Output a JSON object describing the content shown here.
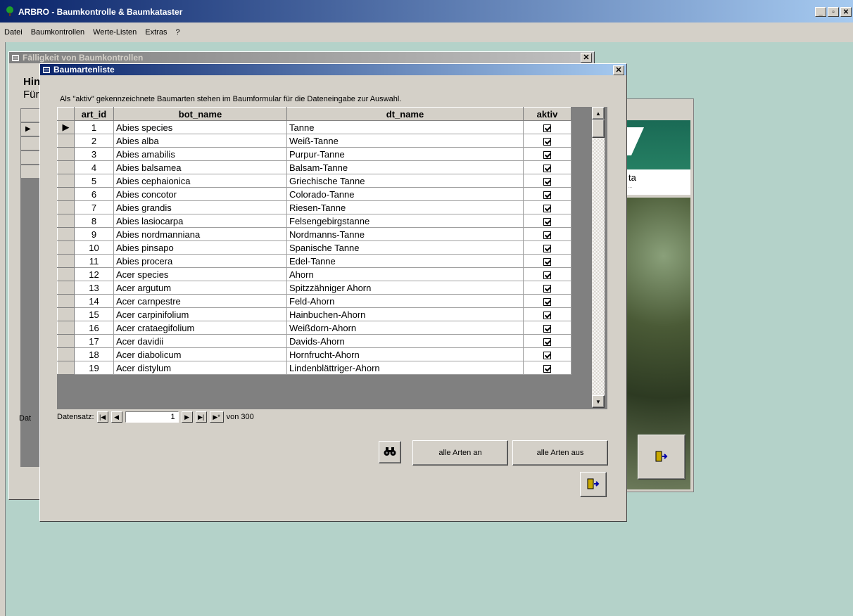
{
  "app": {
    "title": "ARBRO - Baumkontrolle & Baumkataster"
  },
  "window_controls": {
    "minimize": "_",
    "maximize": "▫",
    "close": "✕"
  },
  "menu": [
    {
      "label": "Datei"
    },
    {
      "label": "Baumkontrollen"
    },
    {
      "label": "Werte-Listen"
    },
    {
      "label": "Extras"
    },
    {
      "label": "?"
    }
  ],
  "bg_window": {
    "title": "Fälligkeit von Baumkontrollen",
    "heading": "Hin",
    "subheading": "Für",
    "footer": "Dat"
  },
  "right_panel": {
    "text": "ta",
    "subtext": "..."
  },
  "dialog": {
    "title": "Baumartenliste",
    "info": "Als \"aktiv\" gekennzeichnete Baumarten stehen im Baumformular für die Dateneingabe zur Auswahl.",
    "columns": [
      "art_id",
      "bot_name",
      "dt_name",
      "aktiv"
    ],
    "rows": [
      {
        "id": "1",
        "bot": "Abies species",
        "dt": "Tanne",
        "aktiv": true
      },
      {
        "id": "2",
        "bot": "Abies alba",
        "dt": "Weiß-Tanne",
        "aktiv": true
      },
      {
        "id": "3",
        "bot": "Abies amabilis",
        "dt": "Purpur-Tanne",
        "aktiv": true
      },
      {
        "id": "4",
        "bot": "Abies balsamea",
        "dt": "Balsam-Tanne",
        "aktiv": true
      },
      {
        "id": "5",
        "bot": "Abies cephaionica",
        "dt": "Griechische Tanne",
        "aktiv": true
      },
      {
        "id": "6",
        "bot": "Abies concotor",
        "dt": "Colorado-Tanne",
        "aktiv": true
      },
      {
        "id": "7",
        "bot": "Abies grandis",
        "dt": "Riesen-Tanne",
        "aktiv": true
      },
      {
        "id": "8",
        "bot": "Abies lasiocarpa",
        "dt": "Felsengebirgstanne",
        "aktiv": true
      },
      {
        "id": "9",
        "bot": "Abies nordmanniana",
        "dt": "Nordmanns-Tanne",
        "aktiv": true
      },
      {
        "id": "10",
        "bot": "Abies pinsapo",
        "dt": "Spanische Tanne",
        "aktiv": true
      },
      {
        "id": "11",
        "bot": "Abies procera",
        "dt": "Edel-Tanne",
        "aktiv": true
      },
      {
        "id": "12",
        "bot": "Acer species",
        "dt": "Ahorn",
        "aktiv": true
      },
      {
        "id": "13",
        "bot": "Acer argutum",
        "dt": "Spitzzähniger Ahorn",
        "aktiv": true
      },
      {
        "id": "14",
        "bot": "Acer carnpestre",
        "dt": "Feld-Ahorn",
        "aktiv": true
      },
      {
        "id": "15",
        "bot": "Acer carpinifolium",
        "dt": "Hainbuchen-Ahorn",
        "aktiv": true
      },
      {
        "id": "16",
        "bot": "Acer crataegifolium",
        "dt": "Weißdorn-Ahorn",
        "aktiv": true
      },
      {
        "id": "17",
        "bot": "Acer davidii",
        "dt": "Davids-Ahorn",
        "aktiv": true
      },
      {
        "id": "18",
        "bot": "Acer diabolicum",
        "dt": "Hornfrucht-Ahorn",
        "aktiv": true
      },
      {
        "id": "19",
        "bot": "Acer distylum",
        "dt": "Lindenblättriger-Ahorn",
        "aktiv": true
      }
    ],
    "nav": {
      "label": "Datensatz:",
      "current": "1",
      "total": "von 300"
    },
    "buttons": {
      "search_icon": "binoculars-icon",
      "all_on": "alle Arten an",
      "all_off": "alle Arten aus",
      "exit_icon": "exit-door-icon"
    }
  }
}
